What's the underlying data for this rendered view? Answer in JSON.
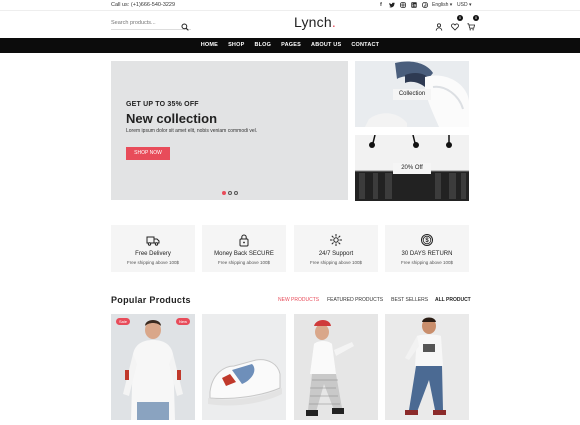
{
  "topbar": {
    "call": "Call us: (+1)666-540-3229",
    "socials": [
      "facebook-icon",
      "twitter-icon",
      "instagram-icon",
      "linkedin-icon",
      "pinterest-icon"
    ],
    "language": "English",
    "currency": "USD"
  },
  "header": {
    "search_placeholder": "Search products...",
    "logo_text": "Lynch",
    "logo_dot": ".",
    "wishlist_count": "0",
    "cart_count": "0"
  },
  "nav": {
    "items": [
      "HOME",
      "SHOP",
      "BLOG",
      "PAGES",
      "ABOUT US",
      "CONTACT"
    ]
  },
  "hero": {
    "subtitle": "GET UP TO 35% OFF",
    "title": "New collection",
    "text": "Lorem ipsum dolor sit amet elit, nobis veniam commodi vel.",
    "button": "SHOP NOW",
    "slides": 3,
    "active_slide": 0
  },
  "banners": [
    {
      "label": "Collection"
    },
    {
      "label": "20% Off"
    }
  ],
  "features": [
    {
      "icon": "truck-icon",
      "title": "Free Delivery",
      "subtitle": "Free shipping above 100$"
    },
    {
      "icon": "lock-icon",
      "title": "Money Back SECURE",
      "subtitle": "Free shipping above 100$"
    },
    {
      "icon": "support-icon",
      "title": "24/7 Support",
      "subtitle": "Free shipping above 100$"
    },
    {
      "icon": "dollar-icon",
      "title": "30 DAYS RETURN",
      "subtitle": "Free shipping above 100$"
    }
  ],
  "products": {
    "title": "Popular Products",
    "tabs": [
      "NEW PRODUCTS",
      "FEATURED PRODUCTS",
      "BEST SELLERS"
    ],
    "all_label": "ALL PRODUCT",
    "badges": {
      "sale": "Sale",
      "new": "New"
    }
  },
  "colors": {
    "accent": "#e84c5a",
    "nav_bg": "#0c0c0c",
    "hero_bg": "#e2e3e4",
    "feature_bg": "#f5f5f5"
  }
}
